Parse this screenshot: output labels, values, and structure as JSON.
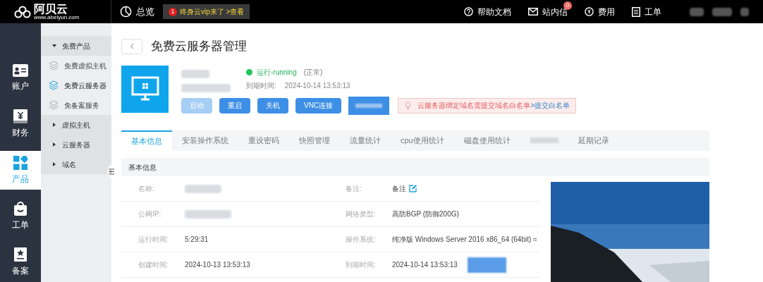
{
  "topbar": {
    "logo": "阿贝云",
    "logo_url": "www.abeiyun.com",
    "overview": "总览",
    "promo": {
      "badge": "1",
      "text": "终身云vip来了 >查看"
    },
    "links": [
      {
        "kind": "help",
        "label": "帮助文档"
      },
      {
        "kind": "mail",
        "label": "站内信",
        "badge": "0"
      },
      {
        "kind": "fee",
        "label": "费用"
      },
      {
        "kind": "ticket",
        "label": "工单"
      }
    ]
  },
  "nav": [
    {
      "kind": "account",
      "label": "账户",
      "selected": false
    },
    {
      "kind": "finance",
      "label": "财务",
      "selected": false
    },
    {
      "kind": "product",
      "label": "产品",
      "selected": true
    },
    {
      "kind": "ticket",
      "label": "工单",
      "selected": false
    },
    {
      "kind": "record",
      "label": "备案",
      "selected": false
    }
  ],
  "sidebar": [
    {
      "label": "免费产品",
      "expanded": true,
      "children": [
        {
          "label": "免费虚拟主机",
          "selected": false
        },
        {
          "label": "免费云服务器",
          "selected": true
        },
        {
          "label": "免备案服务",
          "selected": false
        }
      ]
    },
    {
      "label": "虚拟主机",
      "expanded": false
    },
    {
      "label": "云服务器",
      "expanded": false
    },
    {
      "label": "域名",
      "expanded": false
    }
  ],
  "page_title": "免费云服务器管理",
  "server": {
    "status": "运行-running",
    "status_note": "(正常)",
    "expiry_label": "到期时间:",
    "expiry": "2024-10-14 13:53:13",
    "buttons": [
      {
        "label": "启动",
        "disabled": true
      },
      {
        "label": "重启",
        "disabled": false
      },
      {
        "label": "关机",
        "disabled": false
      },
      {
        "label": "VNC连接",
        "disabled": false
      }
    ],
    "notice": "云服务器绑定域名需提交域名白名单",
    "notice_link": ">提交白名单"
  },
  "tabs": [
    {
      "label": "基本信息",
      "selected": true
    },
    {
      "label": "安装操作系统",
      "selected": false
    },
    {
      "label": "重设密码",
      "selected": false
    },
    {
      "label": "快照管理",
      "selected": false
    },
    {
      "label": "流量统计",
      "selected": false
    },
    {
      "label": "cpu使用统计",
      "selected": false
    },
    {
      "label": "磁盘使用统计",
      "selected": false
    },
    {
      "kind": "blurred",
      "selected": false
    },
    {
      "label": "延期记录",
      "selected": false
    }
  ],
  "section_title": "基本信息",
  "rows": [
    {
      "label": "名称:",
      "label2": "备注:",
      "value2": "备注",
      "edit": true
    },
    {
      "label": "公网IP:",
      "label2": "网络类型:",
      "value2": "高防BGP (防御200G)",
      "edit": false
    },
    {
      "label": "运行时间:",
      "value": "5:29:31",
      "label2": "操作系统:",
      "value2": "纯净版 Windows Server 2016 x86_64 (64bit) ≈",
      "edit": false
    },
    {
      "label": "创建时间:",
      "value": "2024-10-13 13:53:13",
      "label2": "到期时间:",
      "value2": "2024-10-14 13:53:13",
      "edit": false
    }
  ]
}
